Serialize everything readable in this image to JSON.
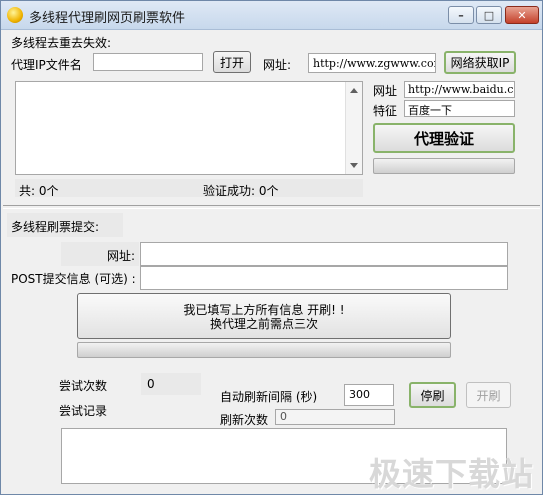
{
  "window": {
    "title": "多线程代理刷网页刷票软件",
    "controls": {
      "minimize": "–",
      "maximize": "□",
      "close": "✕"
    }
  },
  "proxy_section": {
    "header": "多线程去重去失效:",
    "file_label": "代理IP文件名",
    "file_value": "",
    "open_button": "打开",
    "url_label": "网址:",
    "url_value": "http://www.zgwww.com/",
    "fetch_button": "网络获取IP",
    "total_label": "共: 0个",
    "verified_label": "验证成功: 0个"
  },
  "verify_section": {
    "url_label": "网址",
    "url_value": "http://www.baidu.c",
    "feature_label": "特征",
    "feature_value": "百度一下",
    "verify_button": "代理验证"
  },
  "submit_section": {
    "header": "多线程刷票提交:",
    "url_label": "网址:",
    "url_value": "",
    "post_label": "POST提交信息 (可选) :",
    "post_value": "",
    "start_button_line1": "我已填写上方所有信息 开刷! !",
    "start_button_line2": "换代理之前需点三次"
  },
  "stats": {
    "attempts_label": "尝试次数",
    "attempts_value": "0",
    "log_label": "尝试记录",
    "interval_label": "自动刷新间隔 (秒)",
    "interval_value": "300",
    "refresh_count_label": "刷新次数",
    "refresh_count_value": "0",
    "stop_button": "停刷",
    "start_button": "开刷"
  },
  "watermark": "极速下载站"
}
